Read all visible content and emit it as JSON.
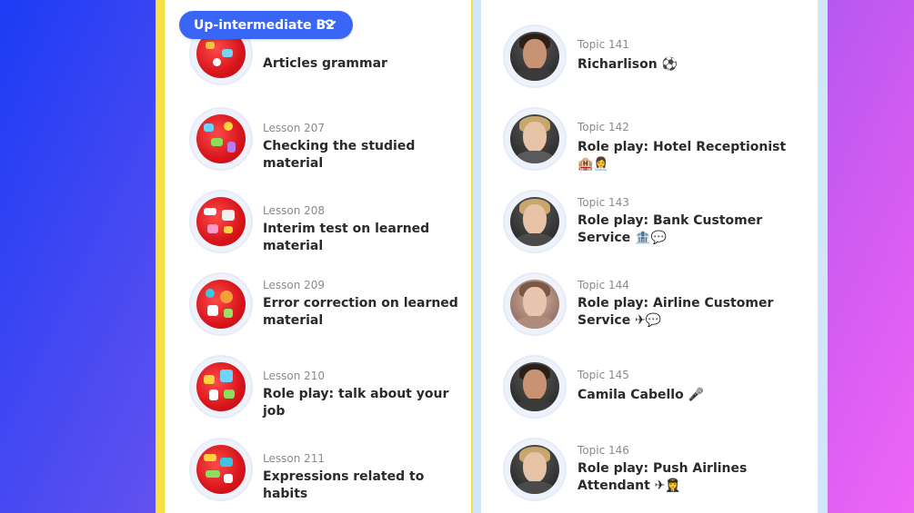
{
  "level_selector": {
    "label": "Up-intermediate B2"
  },
  "lessons": [
    {
      "kicker": "",
      "title": "Articles grammar"
    },
    {
      "kicker": "Lesson 207",
      "title": "Checking the studied material"
    },
    {
      "kicker": "Lesson 208",
      "title": "Interim test on learned material"
    },
    {
      "kicker": "Lesson 209",
      "title": "Error correction on learned material"
    },
    {
      "kicker": "Lesson 210",
      "title": "Role play: talk about your job"
    },
    {
      "kicker": "Lesson 211",
      "title": "Expressions related to habits"
    }
  ],
  "topics": [
    {
      "kicker": "Topic 141",
      "title": "Richarlison ⚽"
    },
    {
      "kicker": "Topic 142",
      "title": "Role play: Hotel Receptionist 🏨👩‍💼"
    },
    {
      "kicker": "Topic 143",
      "title": "Role play: Bank Customer Service 🏦💬"
    },
    {
      "kicker": "Topic 144",
      "title": "Role play: Airline Customer Service ✈💬"
    },
    {
      "kicker": "Topic 145",
      "title": "Camila Cabello 🎤"
    },
    {
      "kicker": "Topic 146",
      "title": "Role play: Push Airlines Attendant ✈👩‍✈️"
    }
  ],
  "colors": {
    "accent": "#3a66f5",
    "left_frame": "#f6e043",
    "right_frame": "#cfe6fb",
    "thumb_red": "#d7151b"
  },
  "icons": {
    "dropdown": "chevron-down-icon"
  }
}
